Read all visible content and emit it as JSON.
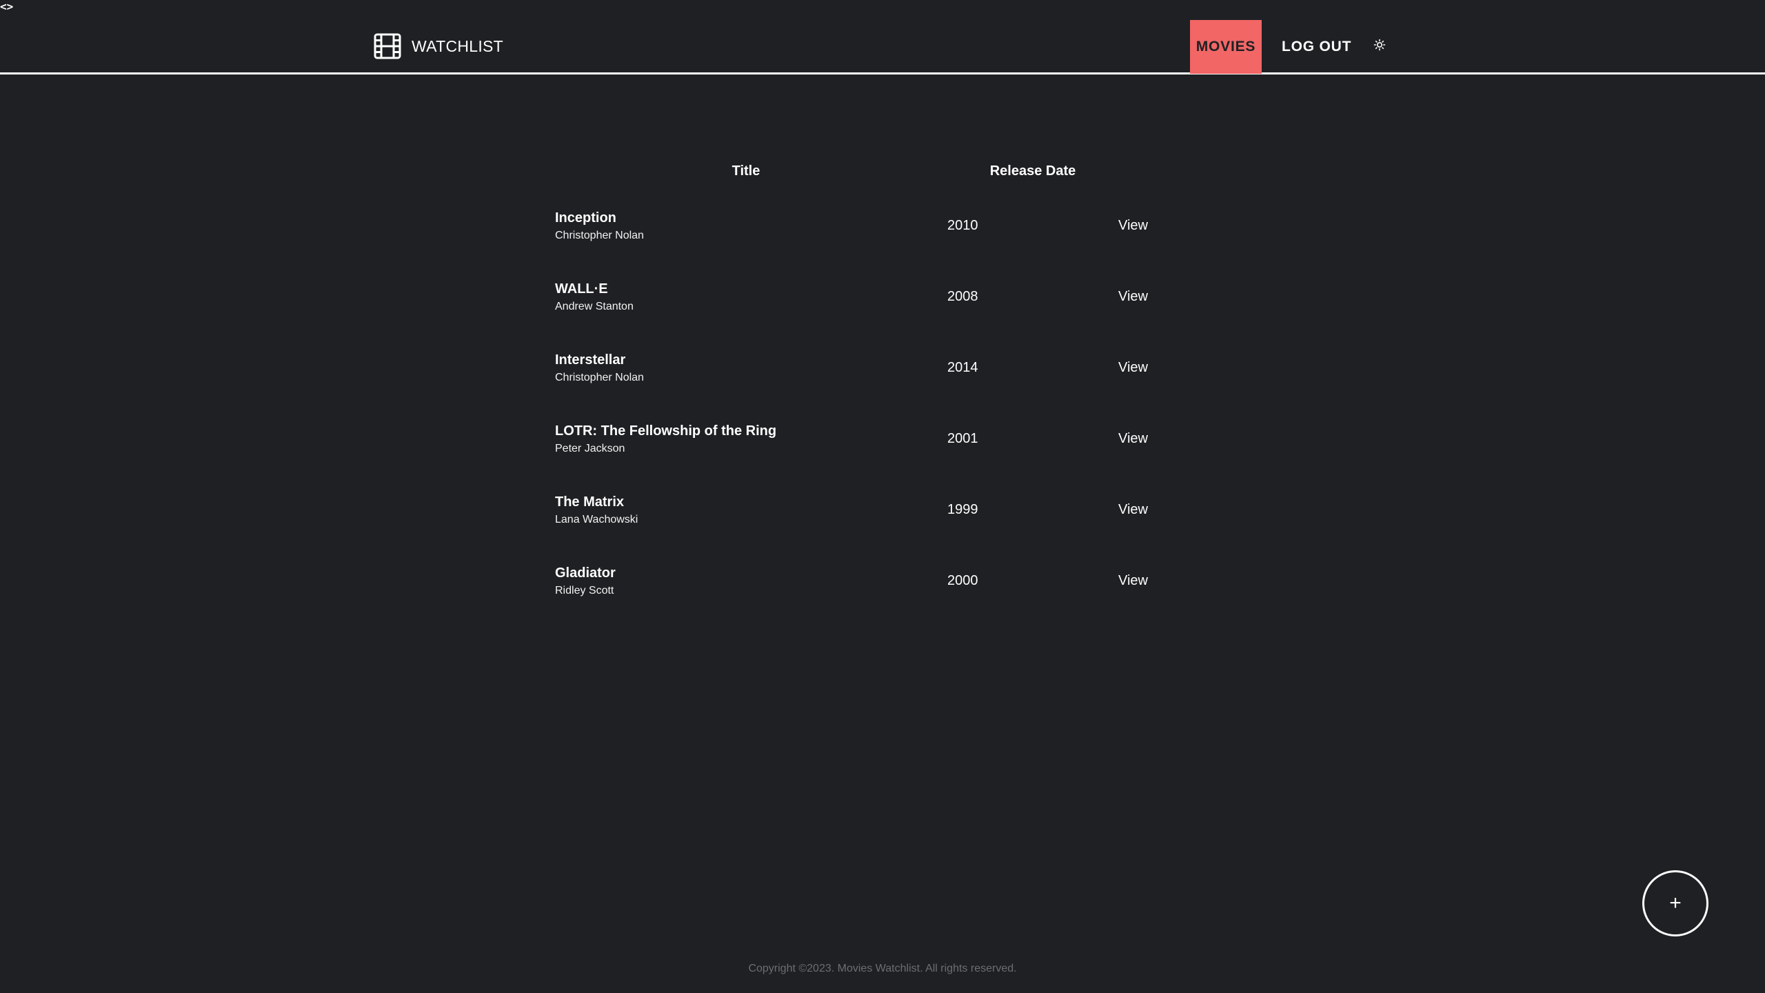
{
  "corner_glyph": "<>",
  "brand": {
    "icon": "film-icon",
    "title": "WATCHLIST"
  },
  "nav": {
    "movies_label": "MOVIES",
    "logout_label": "LOG OUT",
    "theme_icon": "sun-icon"
  },
  "colors": {
    "background": "#1e2023",
    "accent": "#f26666",
    "text": "#ffffff",
    "muted": "#6b6e72"
  },
  "table": {
    "headers": {
      "title": "Title",
      "release_date": "Release Date"
    },
    "rows": [
      {
        "title": "Inception",
        "director": "Christopher Nolan",
        "year": "2010",
        "action": "View"
      },
      {
        "title": "WALL·E",
        "director": "Andrew Stanton",
        "year": "2008",
        "action": "View"
      },
      {
        "title": "Interstellar",
        "director": "Christopher Nolan",
        "year": "2014",
        "action": "View"
      },
      {
        "title": "LOTR: The Fellowship of the Ring",
        "director": "Peter Jackson",
        "year": "2001",
        "action": "View"
      },
      {
        "title": "The Matrix",
        "director": "Lana Wachowski",
        "year": "1999",
        "action": "View"
      },
      {
        "title": "Gladiator",
        "director": "Ridley Scott",
        "year": "2000",
        "action": "View"
      }
    ]
  },
  "fab": {
    "icon": "plus-icon",
    "label": "+"
  },
  "footer": {
    "copyright": "Copyright ©2023. Movies Watchlist. All rights reserved."
  }
}
